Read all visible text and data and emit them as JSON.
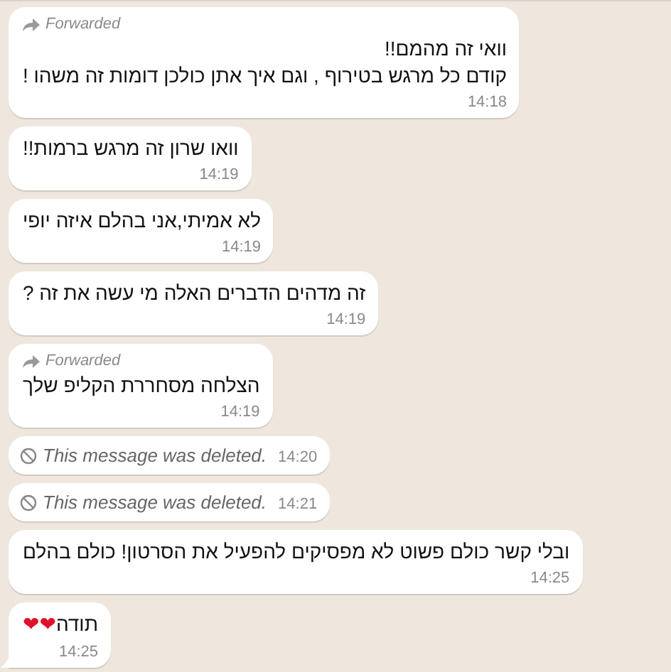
{
  "messages": [
    {
      "kind": "text",
      "forwarded": true,
      "forward_label": "Forwarded",
      "lines": [
        "וואי זה מהמם!!",
        "קודם כל מרגש בטירוף , וגם איך אתן כולכן דומות זה משהו !"
      ],
      "time": "14:18"
    },
    {
      "kind": "text",
      "forwarded": false,
      "lines": [
        "וואו שרון זה מרגש ברמות!!"
      ],
      "time": "14:19"
    },
    {
      "kind": "text",
      "forwarded": false,
      "lines": [
        "לא אמיתי,אני בהלם איזה יופי"
      ],
      "time": "14:19"
    },
    {
      "kind": "text",
      "forwarded": false,
      "lines": [
        "זה מדהים הדברים האלה מי עשה את זה ?"
      ],
      "time": "14:19"
    },
    {
      "kind": "text",
      "forwarded": true,
      "forward_label": "Forwarded",
      "lines": [
        "הצלחה מסחררת הקליפ שלך"
      ],
      "time": "14:19"
    },
    {
      "kind": "deleted",
      "text": "This message was deleted.",
      "time": "14:20"
    },
    {
      "kind": "deleted",
      "text": "This message was deleted.",
      "time": "14:21"
    },
    {
      "kind": "text",
      "forwarded": false,
      "lines": [
        "ובלי קשר כולם פשוט לא מפסיקים להפעיל את הסרטון! כולם בהלם"
      ],
      "time": "14:25"
    },
    {
      "kind": "text",
      "forwarded": false,
      "lines": [
        "תודה"
      ],
      "emoji": "❤❤",
      "time": "14:25",
      "tail": true
    }
  ]
}
